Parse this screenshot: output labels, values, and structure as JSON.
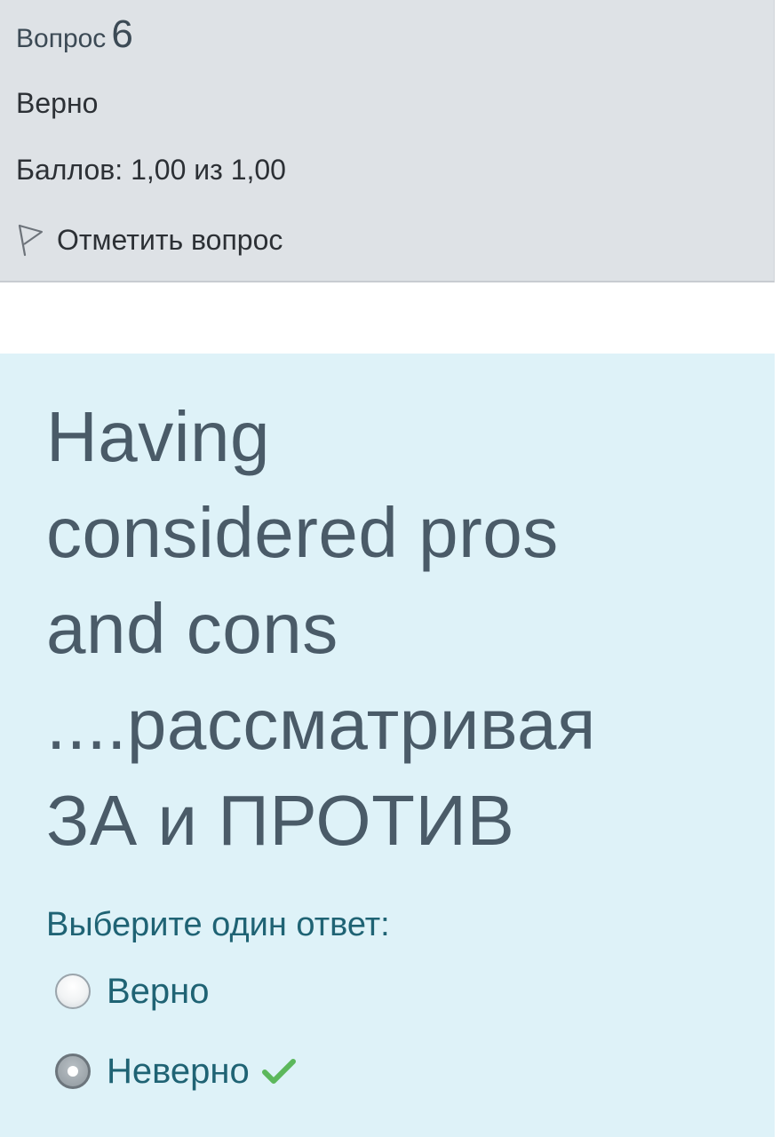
{
  "question_info": {
    "label": "Вопрос",
    "number": "6",
    "state": "Верно",
    "grade": "Баллов: 1,00 из 1,00",
    "flag_label": "Отметить вопрос"
  },
  "question": {
    "text_lines": [
      "Having",
      "considered pros",
      "and cons",
      "....рассматривая",
      "ЗА и ПРОТИВ"
    ],
    "prompt": "Выберите один ответ:",
    "answers": [
      {
        "label": "Верно",
        "selected": false,
        "correct": false
      },
      {
        "label": "Неверно",
        "selected": true,
        "correct": true
      }
    ]
  },
  "colors": {
    "info_panel_bg": "#dee2e6",
    "content_bg": "#def2f8",
    "question_text": "#4a5b68",
    "answer_text": "#1f6374",
    "correct_check": "#5cb85c"
  },
  "icons": {
    "flag": "flag-outline-icon",
    "correct": "checkmark-icon"
  }
}
